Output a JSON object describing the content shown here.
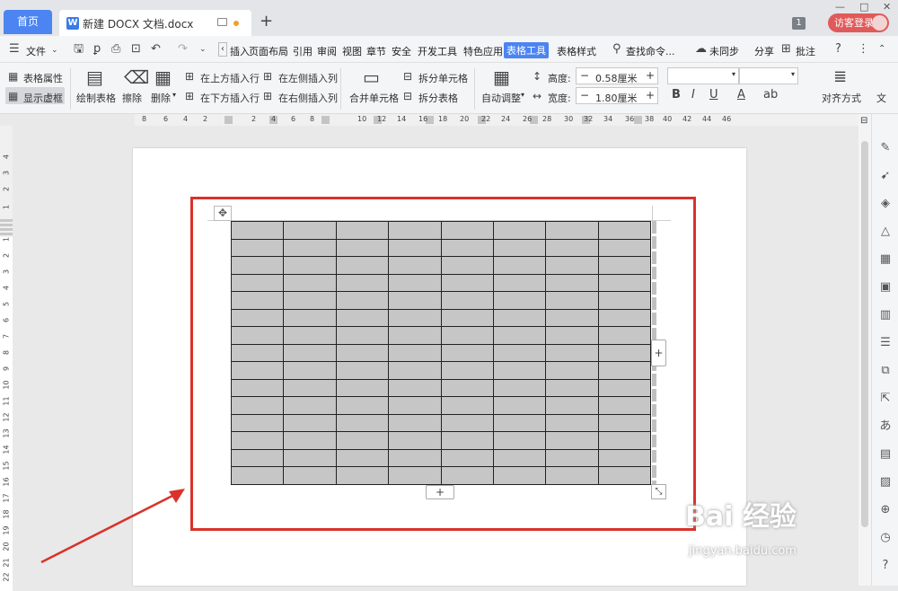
{
  "tabs": {
    "home": "首页",
    "doc_title": "新建 DOCX 文档.docx",
    "new_tab": "+"
  },
  "header_right": {
    "badge_count": "1",
    "login": "访客登录"
  },
  "menu": {
    "file": "文件",
    "items": [
      "插入",
      "页面布局",
      "引用",
      "审阅",
      "视图",
      "章节",
      "安全",
      "开发工具",
      "特色应用"
    ],
    "active": "表格工具",
    "table_style": "表格样式",
    "search": "查找命令...",
    "sync": "未同步",
    "share": "分享",
    "comment": "批注"
  },
  "ribbon": {
    "table_props": "表格属性",
    "show_gridlines": "显示虚框",
    "draw_table": "绘制表格",
    "erase": "擦除",
    "delete": "删除",
    "insert_above": "在上方插入行",
    "insert_below": "在下方插入行",
    "insert_left": "在左侧插入列",
    "insert_right": "在右侧插入列",
    "merge_cells": "合并单元格",
    "split_cells": "拆分单元格",
    "split_table": "拆分表格",
    "auto_fit": "自动调整",
    "height_label": "高度:",
    "height_value": "0.58厘米",
    "width_label": "宽度:",
    "width_value": "1.80厘米",
    "align": "对齐方式",
    "text_dir": "文"
  },
  "hruler": [
    "8",
    "6",
    "4",
    "2",
    "2",
    "4",
    "6",
    "8",
    "10",
    "12",
    "14",
    "16",
    "18",
    "20",
    "22",
    "24",
    "26",
    "28",
    "30",
    "32",
    "34",
    "36",
    "38",
    "40",
    "42",
    "44",
    "46"
  ],
  "vruler": [
    "4",
    "3",
    "2",
    "1",
    "1",
    "2",
    "3",
    "4",
    "5",
    "6",
    "7",
    "8",
    "9",
    "10",
    "11",
    "12",
    "13",
    "14",
    "15",
    "16",
    "17",
    "18",
    "19",
    "20",
    "21",
    "22"
  ],
  "table": {
    "rows": 15,
    "cols": 8
  },
  "watermark": {
    "brand": "Bai 经验",
    "url": "jingyan.baidu.com"
  },
  "colors": {
    "accent": "#4c84f1",
    "highlight": "#d9322a",
    "cell_fill": "#c6c6c6"
  }
}
